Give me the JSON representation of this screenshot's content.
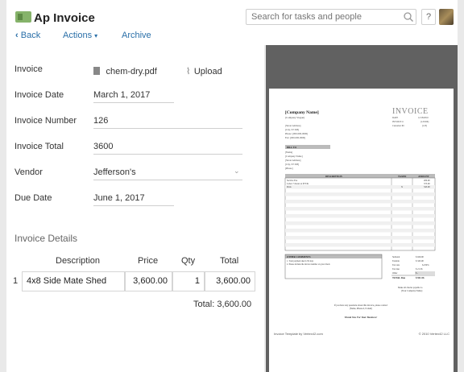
{
  "header": {
    "app_title": "Ap Invoice",
    "back_label": "Back",
    "actions_label": "Actions",
    "archive_label": "Archive",
    "search_placeholder": "Search for tasks and people",
    "help_label": "?"
  },
  "form": {
    "invoice_label": "Invoice",
    "invoice_file": "chem-dry.pdf",
    "upload_label": "Upload",
    "invoice_date_label": "Invoice Date",
    "invoice_date": "March 1, 2017",
    "invoice_number_label": "Invoice Number",
    "invoice_number": "126",
    "invoice_total_label": "Invoice Total",
    "invoice_total": "3600",
    "vendor_label": "Vendor",
    "vendor": "Jefferson's",
    "due_date_label": "Due Date",
    "due_date": "June 1, 2017"
  },
  "details": {
    "title": "Invoice Details",
    "columns": [
      "Description",
      "Price",
      "Qty",
      "Total"
    ],
    "rows": [
      {
        "num": "1",
        "description": "4x8 Side Mate Shed",
        "price": "3,600.00",
        "qty": "1",
        "total": "3,600.00"
      }
    ],
    "total_text": "Total: 3,600.00"
  },
  "pdf": {
    "company_name": "[Company Name]",
    "company_slogan": "[Company Slogan]",
    "address_lines": [
      "[Street Address]",
      "[City, ST ZIP]",
      "Phone: [000-000-0000]",
      "Fax: [000-000-0000]"
    ],
    "invoice_title": "INVOICE",
    "meta_labels": [
      "DATE",
      "INVOICE #",
      "Customer ID"
    ],
    "meta_values": [
      "12/18/2010",
      "[123456]",
      "[123]"
    ],
    "bill_to": "BILL TO",
    "bill_lines": [
      "[Name]",
      "[Company Name]",
      "[Street Address]",
      "[City, ST ZIP]",
      "[Phone]"
    ],
    "columns": [
      "DESCRIPTION",
      "TAXED",
      "AMOUNT"
    ],
    "items": [
      {
        "desc": "Service Fee",
        "tax": "",
        "amount": "200.00"
      },
      {
        "desc": "Labor: 5 hours at $75/hr",
        "tax": "",
        "amount": "375.00"
      },
      {
        "desc": "Parts",
        "tax": "X",
        "amount": "345.00"
      }
    ],
    "other_comments": "OTHER COMMENTS",
    "comments": [
      "1. Total payment due in 30 days",
      "2. Please include the invoice number on your check"
    ],
    "totals_labels": [
      "Subtotal",
      "Taxable",
      "Tax rate",
      "Tax due",
      "Other",
      "TOTAL Due"
    ],
    "totals_values": [
      "$ 920.00",
      "$ 345.00",
      "6.250%",
      "$ 21.56",
      "$ -",
      "$ 941.56"
    ],
    "payable_1": "Make all checks payable to",
    "payable_2": "[Your Company Name]",
    "questions_1": "If you have any questions about this invoice, please contact",
    "questions_2": "[Name, Phone #, E-mail]",
    "thank_you": "Thank You For Your Business!",
    "footer_left": "Invoice Template by Vertex42.com",
    "footer_right": "© 2010 Vertex42 LLC"
  }
}
